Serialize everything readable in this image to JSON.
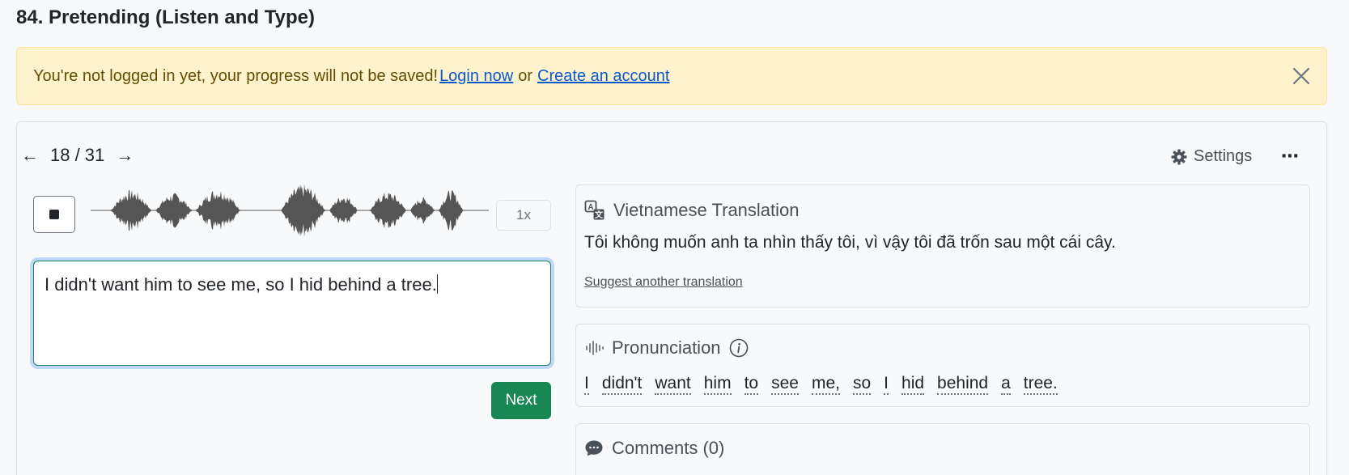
{
  "page": {
    "title": "84. Pretending (Listen and Type)"
  },
  "alert": {
    "message": "You're not logged in yet, your progress will not be saved!",
    "login_label": "Login now",
    "or_text": "or",
    "create_label": "Create an account",
    "close_icon": "close-icon"
  },
  "player": {
    "position": "18 / 31",
    "prev_icon": "arrow-left-icon",
    "next_icon": "arrow-right-icon",
    "settings_label": "Settings",
    "more_icon": "more-horizontal-icon",
    "stop_icon": "stop-icon",
    "speed_label": "1x"
  },
  "answer": {
    "value": "I didn't want him to see me, so I hid behind a tree."
  },
  "next_button": {
    "label": "Next"
  },
  "translation": {
    "title": "Vietnamese Translation",
    "text": "Tôi không muốn anh ta nhìn thấy tôi, vì vậy tôi đã trốn sau một cái cây.",
    "suggest_label": "Suggest another translation"
  },
  "pronunciation": {
    "title": "Pronunciation",
    "words": [
      "I",
      "didn't",
      "want",
      "him",
      "to",
      "see",
      "me,",
      "so",
      "I",
      "hid",
      "behind",
      "a",
      "tree."
    ]
  },
  "comments": {
    "title": "Comments (0)"
  },
  "colors": {
    "alert_bg": "#fff3cd",
    "alert_text": "#664d03",
    "link": "#0a58ca",
    "success": "#198754",
    "waveform": "#555555"
  }
}
